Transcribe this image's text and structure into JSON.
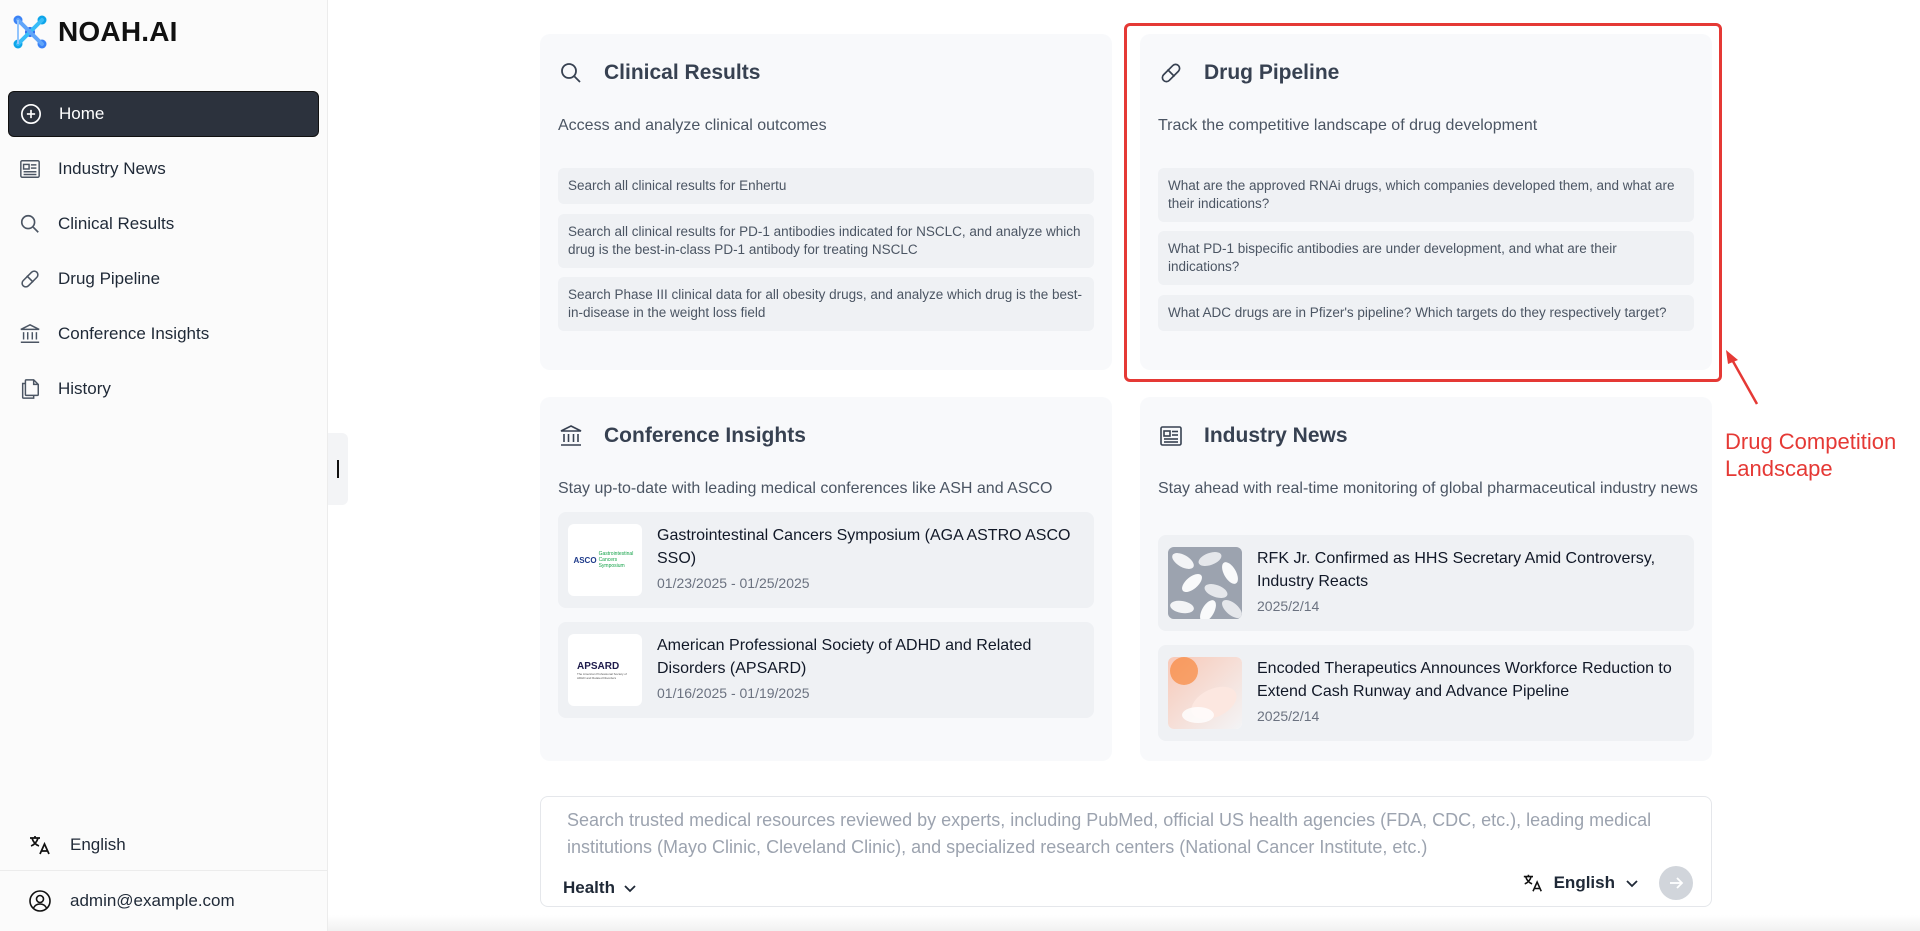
{
  "app": {
    "logo_text": "NOAH.AI"
  },
  "sidebar": {
    "items": [
      {
        "label": "Home",
        "icon": "plus-circle-icon",
        "active": true
      },
      {
        "label": "Industry News",
        "icon": "newspaper-icon"
      },
      {
        "label": "Clinical Results",
        "icon": "search-icon"
      },
      {
        "label": "Drug Pipeline",
        "icon": "pill-icon"
      },
      {
        "label": "Conference Insights",
        "icon": "institution-icon"
      },
      {
        "label": "History",
        "icon": "documents-icon"
      }
    ],
    "language": "English",
    "user_email": "admin@example.com"
  },
  "cards": {
    "clinical": {
      "title": "Clinical Results",
      "description": "Access and analyze clinical outcomes",
      "queries": [
        "Search all clinical results for Enhertu",
        "Search all clinical results for PD-1 antibodies indicated for NSCLC, and analyze which drug is the best-in-class PD-1 antibody for treating NSCLC",
        "Search Phase III clinical data for all obesity drugs, and analyze which drug is the best-in-disease in the weight loss field"
      ]
    },
    "pipeline": {
      "title": "Drug Pipeline",
      "description": "Track the competitive landscape of drug development",
      "queries": [
        "What are the approved RNAi drugs, which companies developed them, and what are their indications?",
        "What PD-1 bispecific antibodies are under development, and what are their indications?",
        "What ADC drugs are in Pfizer's pipeline? Which targets do they respectively target?"
      ]
    },
    "conference": {
      "title": "Conference Insights",
      "description": "Stay up-to-date with leading medical conferences like ASH and ASCO",
      "items": [
        {
          "title": "Gastrointestinal Cancers Symposium (AGA ASTRO ASCO SSO)",
          "date": "01/23/2025 - 01/25/2025",
          "logo_main": "ASCO",
          "logo_sub": "Gastrointestinal Cancers Symposium"
        },
        {
          "title": "American Professional Society of ADHD and Related Disorders (APSARD)",
          "date": "01/16/2025 - 01/19/2025",
          "logo_main": "APSARD",
          "logo_sub": "The American Professional Society of ADHD and Related Disorders"
        }
      ]
    },
    "news": {
      "title": "Industry News",
      "description": "Stay ahead with real-time monitoring of global pharmaceutical industry news",
      "items": [
        {
          "title": "RFK Jr. Confirmed as HHS Secretary Amid Controversy, Industry Reacts",
          "date": "2025/2/14"
        },
        {
          "title": "Encoded Therapeutics Announces Workforce Reduction to Extend Cash Runway and Advance Pipeline",
          "date": "2025/2/14"
        }
      ]
    }
  },
  "annotation": {
    "line1": "Drug Competition",
    "line2": "Landscape",
    "color": "#e53935"
  },
  "search": {
    "placeholder": "Search trusted medical resources reviewed by experts, including PubMed, official US health agencies (FDA, CDC, etc.), leading medical institutions (Mayo Clinic, Cleveland Clinic), and specialized research centers (National Cancer Institute, etc.)",
    "category": "Health",
    "language": "English"
  }
}
